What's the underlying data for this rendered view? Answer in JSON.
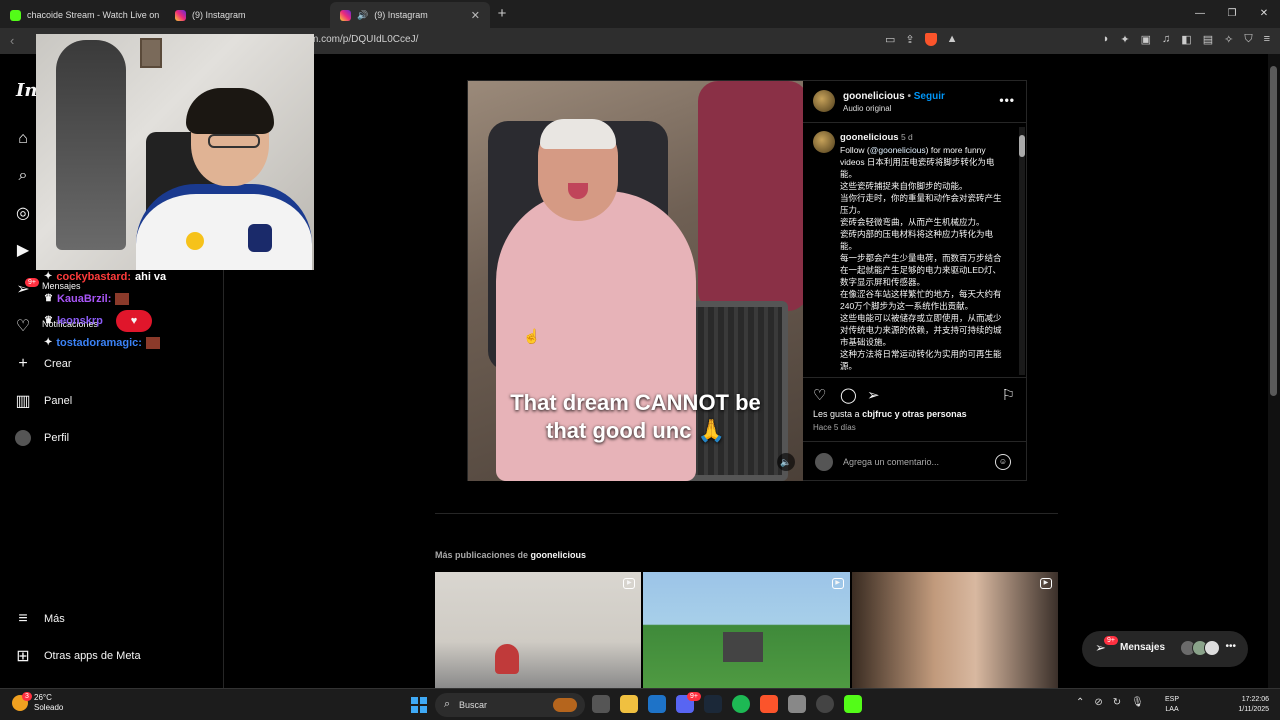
{
  "browser": {
    "tabs": [
      {
        "title": "chacoide Stream - Watch Live on",
        "favicon_color": "#53fc18"
      },
      {
        "title": "(9) Instagram",
        "favicon_color": "#e1306c"
      },
      {
        "title": "(9) Instagram",
        "favicon_color": "#e1306c",
        "active": true,
        "audio": true
      }
    ],
    "url": "m.com/p/DQUIdL0CceJ/",
    "shields_badge": "3"
  },
  "sidebar": {
    "logo": "Ins",
    "items": [
      {
        "label": "",
        "icon": "home-icon"
      },
      {
        "label": "",
        "icon": "search-icon"
      },
      {
        "label": "",
        "icon": "explore-icon"
      },
      {
        "label": "",
        "icon": "reels-icon"
      },
      {
        "label": "Mensajes",
        "icon": "messenger-icon",
        "badge": "9+"
      },
      {
        "label": "Notificaciones",
        "icon": "heart-icon"
      },
      {
        "label": "Crear",
        "icon": "plus-icon"
      },
      {
        "label": "Panel",
        "icon": "dashboard-icon"
      },
      {
        "label": "Perfil",
        "icon": "avatar-icon"
      },
      {
        "label": "Más",
        "icon": "menu-icon"
      },
      {
        "label": "Otras apps de Meta",
        "icon": "meta-apps-icon"
      }
    ]
  },
  "chat_overlay": [
    {
      "user": "cockybastard:",
      "message": "ahi va"
    },
    {
      "user": "KauaBrzil:",
      "message": ""
    },
    {
      "user": "leonskrp",
      "message": ""
    },
    {
      "user": "tostadoramagic:",
      "message": ""
    }
  ],
  "post": {
    "username": "goonelicious",
    "separator": "•",
    "follow": "Seguir",
    "audio": "Audio original",
    "video_caption_line1": "That dream CANNOT be",
    "video_caption_line2": "that good unc 🙏",
    "comment": {
      "username": "goonelicious",
      "time": "5 d",
      "text_prefix": "Follow (",
      "mention": "@goonelicious",
      "text_rest": ") for more funny videos 日本利用压电瓷砖将脚步转化为电能。",
      "paragraphs": [
        "这些瓷砖捕捉来自你脚步的动能。",
        "当你行走时，你的重量和动作会对瓷砖产生压力。",
        "瓷砖会轻微弯曲，从而产生机械应力。",
        "瓷砖内部的压电材料将这种应力转化为电能。",
        "每一步都会产生少量电荷，而数百万步结合在一起就能产生足够的电力来驱动LED灯、数字显示屏和传感器。",
        "在像涩谷车站这样繁忙的地方，每天大约有240万个脚步为这一系统作出贡献。",
        "这些电能可以被储存或立即使用，从而减少对传统电力来源的依赖，并支持可持续的城市基础设施。",
        "这种方法将日常运动转化为实用的可再生能源。"
      ]
    },
    "likes_prefix": "Les gusta a",
    "likes_user": "cbjfruc",
    "likes_suffix": "y otras personas",
    "posted_ago": "Hace 5 días",
    "add_comment_placeholder": "Agrega un comentario..."
  },
  "more_posts": {
    "label": "Más publicaciones de",
    "username": "goonelicious"
  },
  "messages_button": {
    "label": "Mensajes",
    "badge": "9+"
  },
  "taskbar": {
    "temperature": "26°C",
    "weather": "Soleado",
    "search_placeholder": "Buscar",
    "lang_line1": "ESP",
    "lang_line2": "LAA",
    "time": "17:22:06",
    "date": "1/11/2025",
    "weather_badge": "3",
    "discord_badge": "9+"
  },
  "colors": {
    "follow": "#0095f6",
    "badge": "#ff3040",
    "bg": "#000000"
  }
}
